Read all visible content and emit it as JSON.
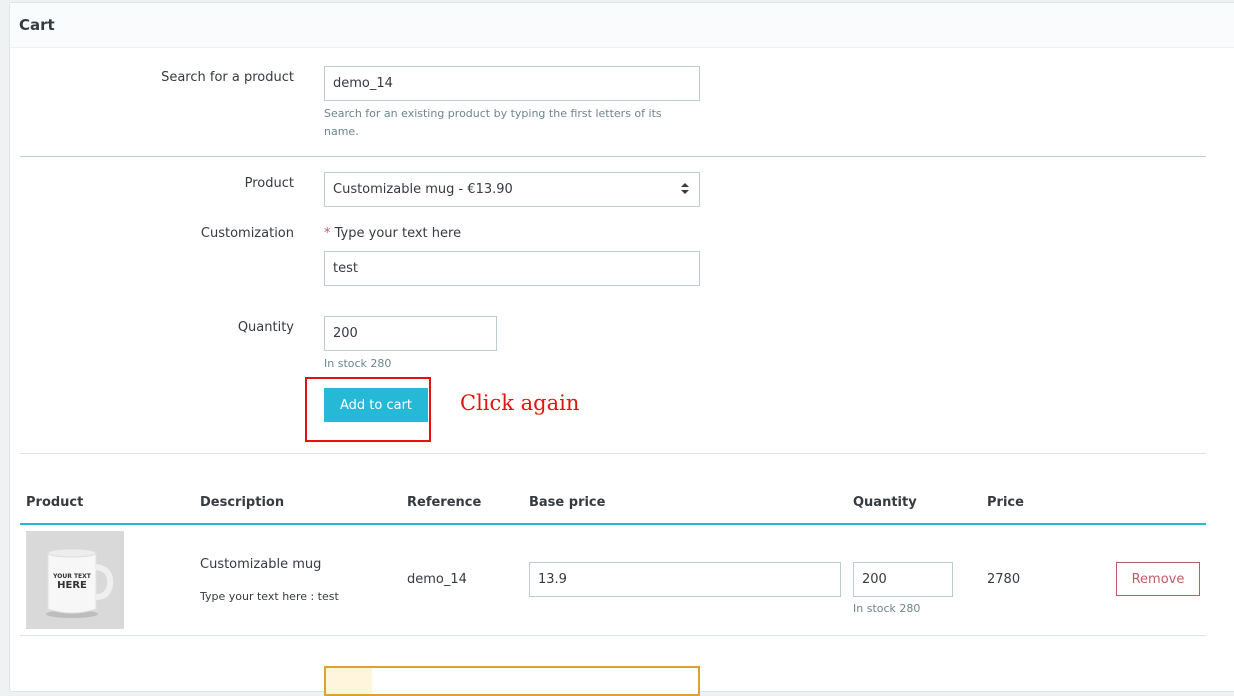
{
  "panel": {
    "title": "Cart"
  },
  "search": {
    "label": "Search for a product",
    "value": "demo_14",
    "help_line1": "Search for an existing product by typing the first letters of its",
    "help_line2": "name."
  },
  "product": {
    "label": "Product",
    "selected": "Customizable mug - €13.90"
  },
  "customization": {
    "label": "Customization",
    "required_mark": "*",
    "field_label": "Type your text here",
    "value": "test"
  },
  "quantity": {
    "label": "Quantity",
    "value": "200",
    "stock": "In stock 280"
  },
  "add_to_cart": {
    "label": "Add to cart"
  },
  "annotation": {
    "text": "Click again",
    "color": "#e5130e"
  },
  "table": {
    "headers": [
      "Product",
      "Description",
      "Reference",
      "Base price",
      "Quantity",
      "Price"
    ],
    "rows": [
      {
        "image_text_1": "YOUR TEXT",
        "image_text_2": "HERE",
        "description": "Customizable mug",
        "customization": "Type your text here : test",
        "reference": "demo_14",
        "base_price": "13.9",
        "quantity": "200",
        "stock": "In stock 280",
        "price": "2780",
        "remove_label": "Remove"
      }
    ]
  },
  "colors": {
    "primary": "#25b9d7",
    "danger": "#c05c67",
    "warning": "#e0a133"
  }
}
